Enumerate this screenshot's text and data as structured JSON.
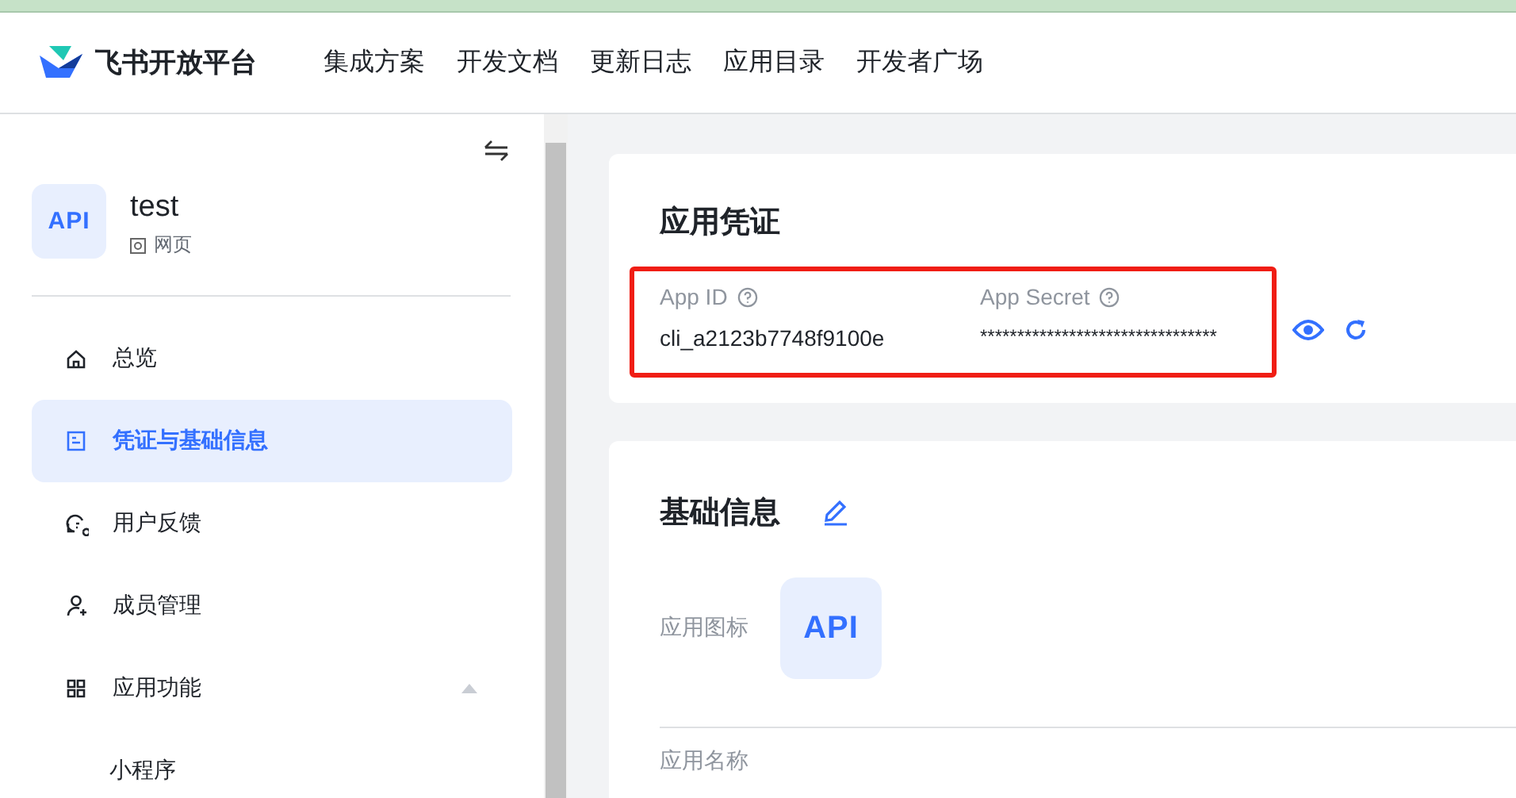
{
  "header": {
    "brand": "飞书开放平台",
    "nav": [
      "集成方案",
      "开发文档",
      "更新日志",
      "应用目录",
      "开发者广场"
    ]
  },
  "app": {
    "logo_text": "API",
    "name": "test",
    "type": "网页"
  },
  "sidebar": {
    "items": [
      {
        "label": "总览",
        "selected": false
      },
      {
        "label": "凭证与基础信息",
        "selected": true
      },
      {
        "label": "用户反馈",
        "selected": false
      },
      {
        "label": "成员管理",
        "selected": false
      },
      {
        "label": "应用功能",
        "selected": false,
        "expanded": true,
        "children": [
          {
            "label": "小程序",
            "selected": false
          }
        ]
      }
    ]
  },
  "credentials": {
    "title": "应用凭证",
    "app_id": {
      "label": "App ID",
      "value": "cli_a2123b7748f9100e"
    },
    "app_secret": {
      "label": "App Secret",
      "value": "********************************"
    }
  },
  "basic_info": {
    "title": "基础信息",
    "icon_label": "应用图标",
    "logo_text": "API",
    "name_label": "应用名称"
  }
}
